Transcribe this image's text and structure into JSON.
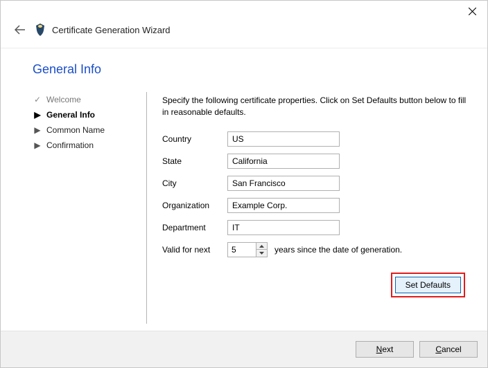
{
  "window": {
    "title": "Certificate Generation Wizard"
  },
  "page": {
    "title": "General Info",
    "instructions": "Specify the following certificate properties. Click on Set Defaults button below to fill in reasonable defaults."
  },
  "steps": [
    {
      "label": "Welcome",
      "state": "done",
      "marker": "✓"
    },
    {
      "label": "General Info",
      "state": "current",
      "marker": "▶"
    },
    {
      "label": "Common Name",
      "state": "pending",
      "marker": "▶"
    },
    {
      "label": "Confirmation",
      "state": "pending",
      "marker": "▶"
    }
  ],
  "form": {
    "country": {
      "label": "Country",
      "value": "US"
    },
    "state": {
      "label": "State",
      "value": "California"
    },
    "city": {
      "label": "City",
      "value": "San Francisco"
    },
    "organization": {
      "label": "Organization",
      "value": "Example Corp."
    },
    "department": {
      "label": "Department",
      "value": "IT"
    },
    "valid": {
      "lead": "Valid for next",
      "value": "5",
      "trail": "years since the date of generation."
    }
  },
  "buttons": {
    "set_defaults": "Set Defaults",
    "next": "Next",
    "cancel": "Cancel"
  }
}
